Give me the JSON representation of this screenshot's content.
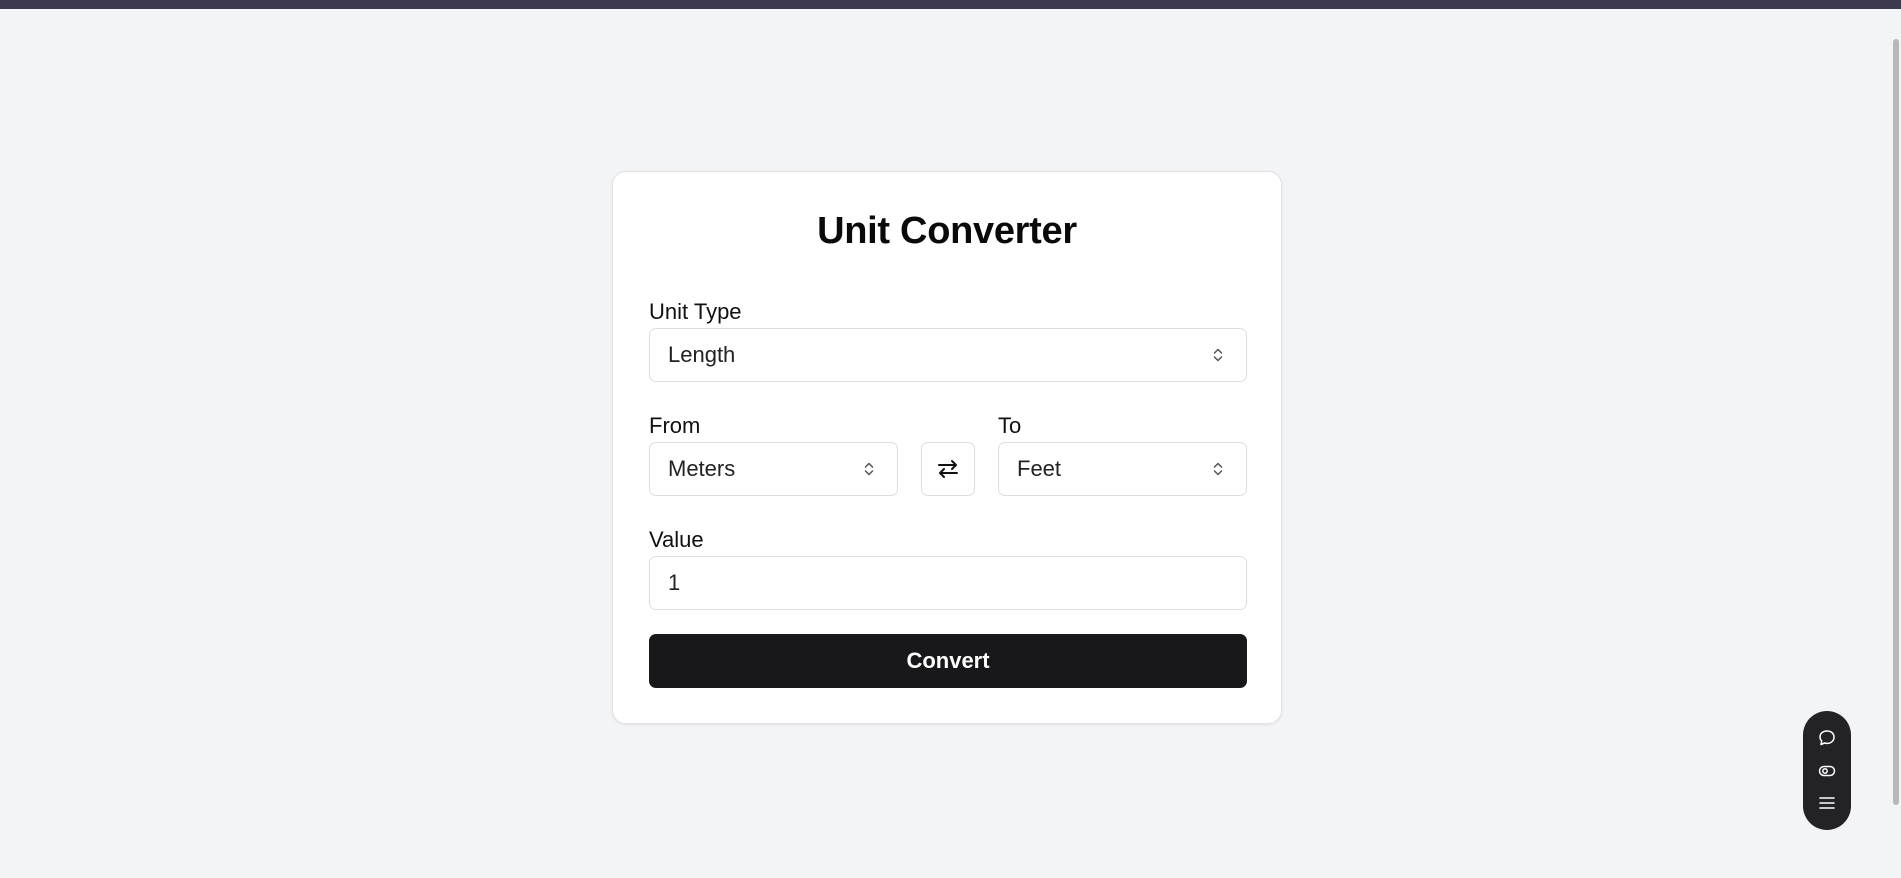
{
  "app": {
    "title": "Unit Converter"
  },
  "form": {
    "unit_type": {
      "label": "Unit Type",
      "selected": "Length"
    },
    "from": {
      "label": "From",
      "selected": "Meters"
    },
    "to": {
      "label": "To",
      "selected": "Feet"
    },
    "value": {
      "label": "Value",
      "current": "1"
    },
    "convert_label": "Convert"
  },
  "icons": {
    "swap": "swap-arrows-icon",
    "select_chevron": "chevron-updown-icon",
    "floating_toolbar": [
      "chat-icon",
      "eye-icon",
      "menu-icon"
    ]
  },
  "colors": {
    "page_background": "#f3f4f6",
    "top_bar": "#3d3a50",
    "card_background": "#ffffff",
    "primary_button": "#18181a",
    "primary_button_text": "#ffffff",
    "floating_toolbar": "#232326"
  }
}
